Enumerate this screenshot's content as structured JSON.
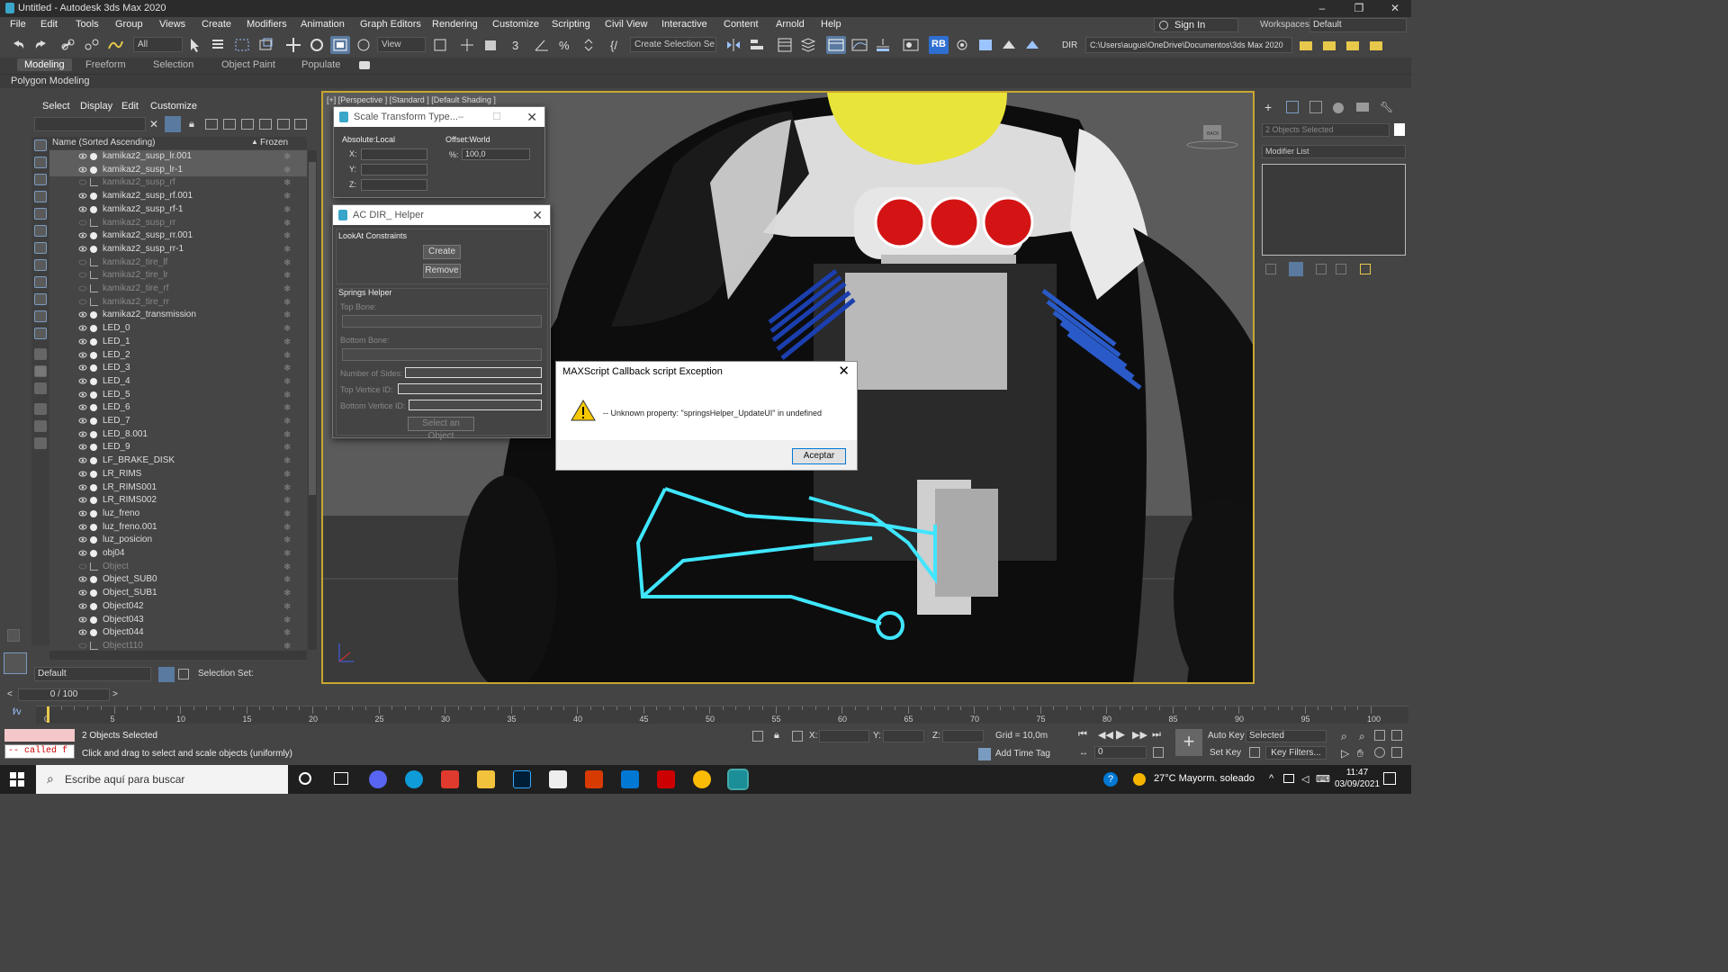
{
  "window": {
    "title": "Untitled - Autodesk 3ds Max 2020",
    "controls": [
      "–",
      "❐",
      "✕"
    ]
  },
  "menubar": {
    "items": [
      "File",
      "Edit",
      "Tools",
      "Group",
      "Views",
      "Create",
      "Modifiers",
      "Animation",
      "Graph Editors",
      "Rendering",
      "Customize",
      "Scripting",
      "Civil View",
      "Interactive",
      "Content",
      "Arnold",
      "Help"
    ],
    "sign_in": "Sign In",
    "workspaces_label": "Workspaces:",
    "workspace_value": "Default"
  },
  "toolbar": {
    "filter_value": "All",
    "refcoord_value": "View",
    "selection_set_value": "Create Selection Se",
    "rb_label": "RB",
    "dir_label": "DIR",
    "project_path": "C:\\Users\\augus\\OneDrive\\Documentos\\3ds Max 2020"
  },
  "ribbon": {
    "tabs": [
      "Modeling",
      "Freeform",
      "Selection",
      "Object Paint",
      "Populate"
    ],
    "active_tab": "Modeling",
    "panel_label": "Polygon Modeling"
  },
  "scene_explorer": {
    "menu": [
      "Select",
      "Display",
      "Edit",
      "Customize"
    ],
    "column_name": "Name (Sorted Ascending)",
    "column_frozen": "Frozen",
    "rows": [
      {
        "name": "kamikaz2_susp_lr.001",
        "state": "selected"
      },
      {
        "name": "kamikaz2_susp_lr-1",
        "state": "selected"
      },
      {
        "name": "kamikaz2_susp_rf",
        "state": "hidden"
      },
      {
        "name": "kamikaz2_susp_rf.001",
        "state": "visible"
      },
      {
        "name": "kamikaz2_susp_rf-1",
        "state": "visible"
      },
      {
        "name": "kamikaz2_susp_rr",
        "state": "hidden"
      },
      {
        "name": "kamikaz2_susp_rr.001",
        "state": "visible"
      },
      {
        "name": "kamikaz2_susp_rr-1",
        "state": "visible"
      },
      {
        "name": "kamikaz2_tire_lf",
        "state": "hidden"
      },
      {
        "name": "kamikaz2_tire_lr",
        "state": "hidden"
      },
      {
        "name": "kamikaz2_tire_rf",
        "state": "hidden"
      },
      {
        "name": "kamikaz2_tire_rr",
        "state": "hidden"
      },
      {
        "name": "kamikaz2_transmission",
        "state": "visible"
      },
      {
        "name": "LED_0",
        "state": "visible"
      },
      {
        "name": "LED_1",
        "state": "visible"
      },
      {
        "name": "LED_2",
        "state": "visible"
      },
      {
        "name": "LED_3",
        "state": "visible"
      },
      {
        "name": "LED_4",
        "state": "visible"
      },
      {
        "name": "LED_5",
        "state": "visible"
      },
      {
        "name": "LED_6",
        "state": "visible"
      },
      {
        "name": "LED_7",
        "state": "visible"
      },
      {
        "name": "LED_8.001",
        "state": "visible"
      },
      {
        "name": "LED_9",
        "state": "visible"
      },
      {
        "name": "LF_BRAKE_DISK",
        "state": "visible"
      },
      {
        "name": "LR_RIMS",
        "state": "visible"
      },
      {
        "name": "LR_RIMS001",
        "state": "visible"
      },
      {
        "name": "LR_RIMS002",
        "state": "visible"
      },
      {
        "name": "luz_freno",
        "state": "visible"
      },
      {
        "name": "luz_freno.001",
        "state": "visible"
      },
      {
        "name": "luz_posicion",
        "state": "visible"
      },
      {
        "name": "obj04",
        "state": "visible"
      },
      {
        "name": "Object",
        "state": "hidden"
      },
      {
        "name": "Object_SUB0",
        "state": "visible"
      },
      {
        "name": "Object_SUB1",
        "state": "visible"
      },
      {
        "name": "Object042",
        "state": "visible"
      },
      {
        "name": "Object043",
        "state": "visible"
      },
      {
        "name": "Object044",
        "state": "visible"
      },
      {
        "name": "Object110",
        "state": "hidden"
      }
    ],
    "layer_value": "Default",
    "selection_set_label": "Selection Set:"
  },
  "viewport": {
    "label": "[+] [Perspective ] [Standard ] [Default Shading ]",
    "viewcube_label": "BACK"
  },
  "scale_dialog": {
    "title": "Scale Transform Type...",
    "left_group": "Absolute:Local",
    "right_group": "Offset:World",
    "x_label": "X:",
    "y_label": "Y:",
    "z_label": "Z:",
    "pct_label": "%:",
    "pct_value": "100,0"
  },
  "helper_dialog": {
    "title": "AC DIR_ Helper",
    "lookat_group": "LookAt Constraints",
    "create_btn": "Create",
    "remove_btn": "Remove",
    "springs_group": "Springs Helper",
    "top_bone": "Top Bone:",
    "bottom_bone": "Bottom Bone:",
    "num_sides": "Number of Sides:",
    "top_vertice": "Top Vertice ID:",
    "bottom_vertice": "Bottom Vertice ID:",
    "select_btn": "Select an Object"
  },
  "error_dialog": {
    "title": "MAXScript Callback script Exception",
    "message": "-- Unknown property: \"springsHelper_UpdateUI\" in undefined",
    "ok_btn": "Aceptar"
  },
  "command_panel": {
    "selection_field": "2 Objects Selected",
    "modifier_list": "Modifier List"
  },
  "timeline": {
    "frame_display": "0 / 100",
    "ticks": [
      "0",
      "5",
      "10",
      "15",
      "20",
      "25",
      "30",
      "35",
      "40",
      "45",
      "50",
      "55",
      "60",
      "65",
      "70",
      "75",
      "80",
      "85",
      "90",
      "95",
      "100"
    ]
  },
  "status": {
    "maxscript_text": "-- called f",
    "objects_selected": "2 Objects Selected",
    "hint": "Click and drag to select and scale objects (uniformly)",
    "x_label": "X:",
    "y_label": "Y:",
    "z_label": "Z:",
    "grid": "Grid = 10,0m",
    "add_time_tag": "Add Time Tag",
    "auto_key": "Auto Key",
    "set_key": "Set Key",
    "key_mode": "Selected",
    "key_filters": "Key Filters...",
    "current_frame": "0"
  },
  "taskbar": {
    "search_placeholder": "Escribe aquí para buscar",
    "weather": "27°C  Mayorm. soleado",
    "time": "11:47",
    "date": "03/09/2021"
  },
  "colors": {
    "accent_blue": "#5a7aa0",
    "viewport_border": "#c8a630",
    "selection_highlight": "#3fe6ff",
    "taillight_red": "#d41414"
  }
}
